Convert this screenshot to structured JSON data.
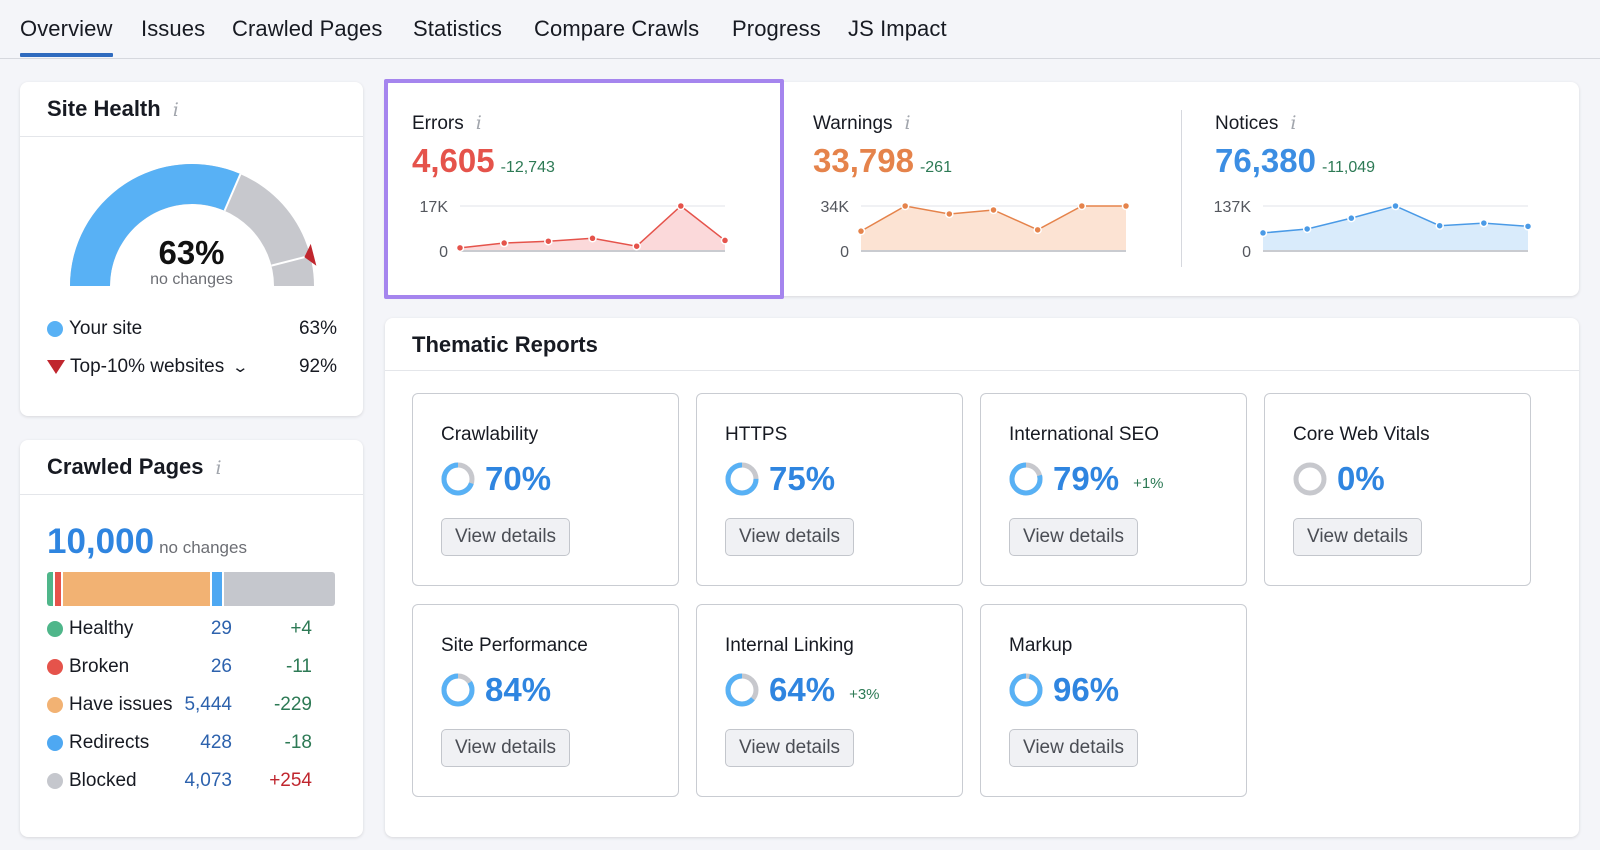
{
  "tabs": [
    {
      "label": "Overview",
      "active": true
    },
    {
      "label": "Issues",
      "active": false
    },
    {
      "label": "Crawled Pages",
      "active": false
    },
    {
      "label": "Statistics",
      "active": false
    },
    {
      "label": "Compare Crawls",
      "active": false
    },
    {
      "label": "Progress",
      "active": false
    },
    {
      "label": "JS Impact",
      "active": false
    }
  ],
  "site_health": {
    "title": "Site Health",
    "info_icon": "i",
    "score_label": "63%",
    "score_value": 63,
    "benchmark_value": 92,
    "change_text": "no changes",
    "legend": [
      {
        "label": "Your site",
        "value": "63%",
        "marker": "dot",
        "color": "#58b1f5"
      },
      {
        "label": "Top-10% websites",
        "value": "92%",
        "marker": "triangle-down",
        "color": "#c0262e",
        "chevron": "⌄"
      }
    ],
    "colors": {
      "fill": "#58b1f5",
      "rest": "#c7c8cd",
      "marker": "#c0262e"
    }
  },
  "crawled_pages": {
    "title": "Crawled Pages",
    "info_icon": "i",
    "total": "10,000",
    "change_text": "no changes",
    "rows": [
      {
        "label": "Healthy",
        "count": "29",
        "delta": "+4",
        "color": "#4fb68a",
        "delta_color": "#2d7a55",
        "share": 0.75
      },
      {
        "label": "Broken",
        "count": "26",
        "delta": "-11",
        "color": "#e5534b",
        "delta_color": "#2d7a55",
        "share": 0.75
      },
      {
        "label": "Have issues",
        "count": "5,444",
        "delta": "-229",
        "color": "#f2b273",
        "delta_color": "#2d7a55",
        "share": 14.2
      },
      {
        "label": "Redirects",
        "count": "428",
        "delta": "-18",
        "color": "#4ea8f2",
        "delta_color": "#2d7a55",
        "share": 1.1
      },
      {
        "label": "Blocked",
        "count": "4,073",
        "delta": "+254",
        "color": "#c5c7cd",
        "delta_color": "#c0262e",
        "share": 10.6
      }
    ]
  },
  "metrics": [
    {
      "label": "Errors",
      "info_icon": "i",
      "value": "4,605",
      "delta": "-12,743",
      "color": "#e5534b",
      "fill": "#fbd9da",
      "ymax_label": "17K",
      "ymin_label": "0",
      "ymax": 17000,
      "series": [
        1200,
        3000,
        3700,
        4800,
        1800,
        17000,
        4000
      ],
      "highlighted": true
    },
    {
      "label": "Warnings",
      "info_icon": "i",
      "value": "33,798",
      "delta": "-261",
      "color": "#e5834b",
      "fill": "#fce3d3",
      "ymax_label": "34K",
      "ymin_label": "0",
      "ymax": 34000,
      "series": [
        15000,
        34000,
        28000,
        31000,
        16000,
        34000,
        34000
      ],
      "highlighted": false
    },
    {
      "label": "Notices",
      "info_icon": "i",
      "value": "76,380",
      "delta": "-11,049",
      "color": "#4a9ae6",
      "fill": "#d9ebfb",
      "ymax_label": "137K",
      "ymin_label": "0",
      "ymax": 137000,
      "series": [
        55000,
        67000,
        100000,
        137000,
        77000,
        85000,
        75000
      ],
      "highlighted": false
    }
  ],
  "thematic": {
    "title": "Thematic Reports",
    "button_label": "View details",
    "reports": [
      {
        "name": "Crawlability",
        "pct": "70%",
        "value": 70,
        "delta": ""
      },
      {
        "name": "HTTPS",
        "pct": "75%",
        "value": 75,
        "delta": ""
      },
      {
        "name": "International SEO",
        "pct": "79%",
        "value": 79,
        "delta": "+1%"
      },
      {
        "name": "Core Web Vitals",
        "pct": "0%",
        "value": 0,
        "delta": ""
      },
      {
        "name": "Site Performance",
        "pct": "84%",
        "value": 84,
        "delta": ""
      },
      {
        "name": "Internal Linking",
        "pct": "64%",
        "value": 64,
        "delta": "+3%"
      },
      {
        "name": "Markup",
        "pct": "96%",
        "value": 96,
        "delta": ""
      }
    ],
    "colors": {
      "ring_fill": "#58b1f5",
      "ring_rest": "#c7c8cd"
    }
  }
}
